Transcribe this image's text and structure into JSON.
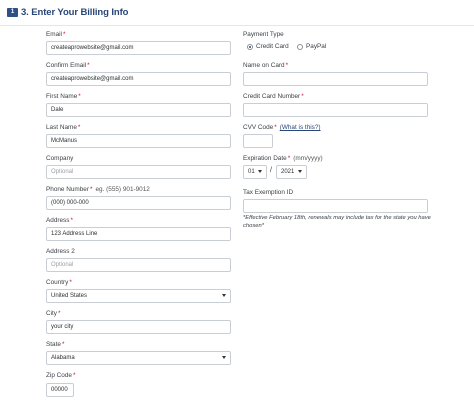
{
  "header": {
    "step_icon_text": "1",
    "title": "3. Enter Your Billing Info"
  },
  "left": {
    "email": {
      "label": "Email",
      "value": "createaprowebsite@gmail.com"
    },
    "confirm_email": {
      "label": "Confirm Email",
      "value": "createaprowebsite@gmail.com"
    },
    "first_name": {
      "label": "First Name",
      "value": "Dale"
    },
    "last_name": {
      "label": "Last Name",
      "value": "McManus"
    },
    "company": {
      "label": "Company",
      "placeholder": "Optional"
    },
    "phone": {
      "label": "Phone Number",
      "hint": "eg. (555) 901-9012",
      "value": "(000) 000-000"
    },
    "address": {
      "label": "Address",
      "value": "123 Address Line"
    },
    "address2": {
      "label": "Address 2",
      "placeholder": "Optional"
    },
    "country": {
      "label": "Country",
      "selected": "United States"
    },
    "city": {
      "label": "City",
      "value": "your city"
    },
    "state": {
      "label": "State",
      "selected": "Alabama"
    },
    "zip": {
      "label": "Zip Code",
      "value": "00000"
    }
  },
  "right": {
    "payment_type": {
      "label": "Payment Type",
      "option1": "Credit Card",
      "option2": "PayPal",
      "selected": "Credit Card"
    },
    "name_on_card": {
      "label": "Name on Card"
    },
    "card_number": {
      "label": "Credit Card Number"
    },
    "cvv": {
      "label": "CVV Code",
      "link": "(What is this?)"
    },
    "expiration": {
      "label": "Expiration Date",
      "hint": "(mm/yyyy)",
      "month": "01",
      "year": "2021",
      "separator": "/"
    },
    "tax": {
      "label": "Tax Exemption ID",
      "note": "*Effective February 18th, renewals may include tax for the state you have chosen*"
    }
  },
  "required_marker": "*",
  "colors": {
    "accent": "#2a4677",
    "required": "#c8102e",
    "border": "#c9ced4"
  }
}
